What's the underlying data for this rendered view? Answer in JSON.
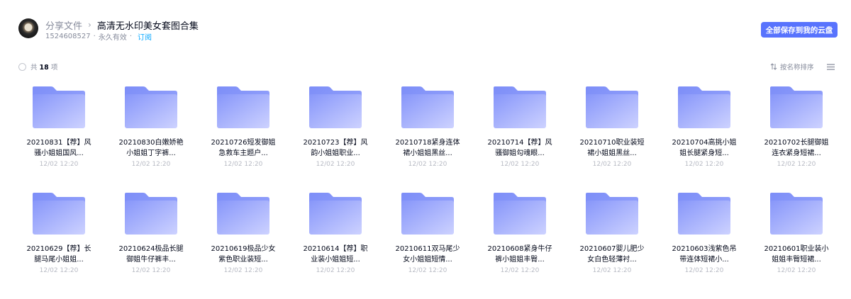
{
  "header": {
    "breadcrumb_root": "分享文件",
    "breadcrumb_separator": "›",
    "title": "高清无水印美女套图合集",
    "user_id": "1524608527",
    "validity": "永久有效",
    "separator": "·",
    "subscribe_label": "订阅",
    "save_all_label": "全部保存到我的云盘"
  },
  "toolbar": {
    "count_prefix": "共",
    "count_value": "18",
    "count_suffix": "项",
    "sort_label": "按名称排序",
    "sort_icon": "sort-arrows-icon",
    "view_icon": "list-view-icon"
  },
  "colors": {
    "accent": "#5873fd",
    "folder_dark": "#7b8cf7",
    "folder_light": "#c7cdff",
    "link": "#06a7ff"
  },
  "files": [
    {
      "name": "20210831【荐】风骚小姐姐国风...",
      "date": "12/02 12:20"
    },
    {
      "name": "20210830白嫩娇艳小姐姐丁字裤...",
      "date": "12/02 12:20"
    },
    {
      "name": "20210726短发御姐急救车主题户...",
      "date": "12/02 12:20"
    },
    {
      "name": "20210723【荐】风韵小姐姐职业...",
      "date": "12/02 12:20"
    },
    {
      "name": "20210718紧身连体裙小姐姐黑丝...",
      "date": "12/02 12:20"
    },
    {
      "name": "20210714【荐】风骚御姐勾魂眼...",
      "date": "12/02 12:20"
    },
    {
      "name": "20210710职业装短裙小姐姐黑丝...",
      "date": "12/02 12:20"
    },
    {
      "name": "20210704高挑小姐姐长腿紧身短...",
      "date": "12/02 12:20"
    },
    {
      "name": "20210702长腿御姐连衣紧身短裙...",
      "date": "12/02 12:20"
    },
    {
      "name": "20210629【荐】长腿马尾小姐姐...",
      "date": "12/02 12:20"
    },
    {
      "name": "20210624极品长腿御姐牛仔裤丰...",
      "date": "12/02 12:20"
    },
    {
      "name": "20210619极品少女紫色职业装短...",
      "date": "12/02 12:20"
    },
    {
      "name": "20210614【荐】职业装小姐姐短...",
      "date": "12/02 12:20"
    },
    {
      "name": "20210611双马尾少女小姐姐短情...",
      "date": "12/02 12:20"
    },
    {
      "name": "20210608紧身牛仔裤小姐姐丰臀...",
      "date": "12/02 12:20"
    },
    {
      "name": "20210607婴儿肥少女白色轻薄衬...",
      "date": "12/02 12:20"
    },
    {
      "name": "20210603浅紫色吊带连体短裙小...",
      "date": "12/02 12:20"
    },
    {
      "name": "20210601职业装小姐姐丰臀短裙...",
      "date": "12/02 12:20"
    }
  ]
}
